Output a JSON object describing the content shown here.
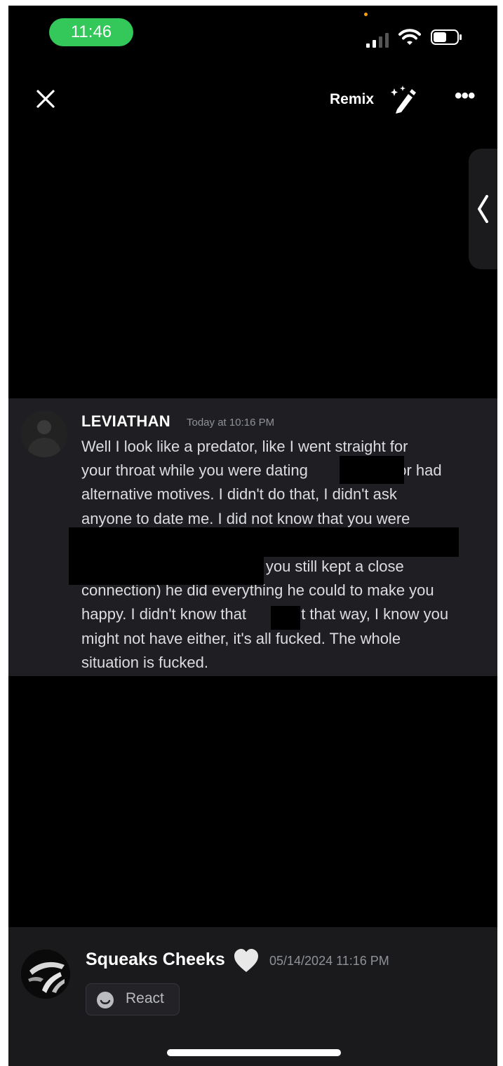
{
  "status_bar": {
    "time": "11:46"
  },
  "top_bar": {
    "remix_label": "Remix",
    "close_icon": "close-icon",
    "remix_icon": "magic-pencil-icon",
    "more_icon": "more-horizontal-icon",
    "more_label": "•••"
  },
  "side_panel": {
    "icon": "chevron-left-icon"
  },
  "message": {
    "author": "LEVIATHAN",
    "timestamp": "Today at 10:16 PM",
    "lines": [
      "Well I look like a predator, like I went straight for",
      "your throat while you were dating                     or had",
      "alternative motives. I didn't do that, I didn't ask",
      "anyone to date me. I did not know that you were",
      "",
      "                                           you still kept a close",
      "connection) he did everything he could to make you",
      "happy. I didn't know that         felt that way, I know you",
      "might not have either, it's all fucked. The whole",
      "situation is fucked."
    ]
  },
  "footer": {
    "user_name": "Squeaks Cheeks",
    "badge_icon": "heart-icon",
    "timestamp": "05/14/2024 11:16 PM",
    "react_label": "React",
    "react_icon": "smiley-icon"
  },
  "colors": {
    "background": "#000000",
    "time_pill": "#34c759",
    "message_panel": "#1f1f23",
    "text": "#dcddde",
    "muted": "#8e9297"
  }
}
